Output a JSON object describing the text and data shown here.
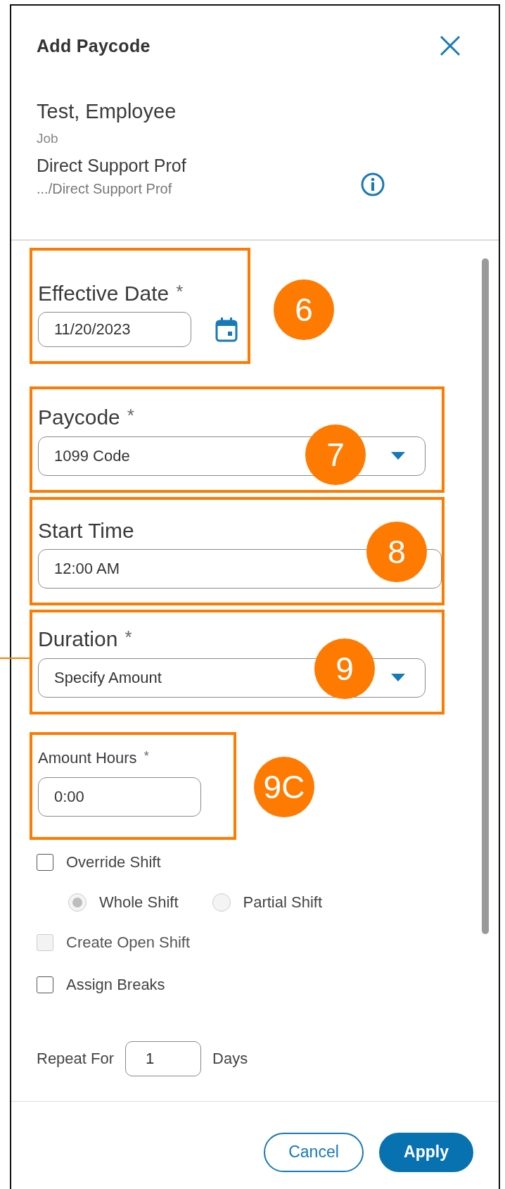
{
  "dialog": {
    "title": "Add Paycode",
    "employee": {
      "name": "Test, Employee",
      "job_label": "Job",
      "job": "Direct Support Prof",
      "job_path": ".../Direct Support Prof"
    },
    "fields": [
      {
        "kind": "date",
        "label": "Effective Date",
        "required_mark": "*",
        "value": "11/20/2023",
        "callout": "6",
        "leader": false
      },
      {
        "kind": "select",
        "label": "Paycode",
        "required_mark": "*",
        "value": "1099 Code",
        "callout": "7",
        "leader": false
      },
      {
        "kind": "time",
        "label": "Start Time",
        "value": "12:00 AM",
        "callout": "8",
        "leader": false
      },
      {
        "kind": "select",
        "label": "Duration",
        "required_mark": "*",
        "value": "Specify Amount",
        "callout": "9",
        "leader": true
      },
      {
        "kind": "hours",
        "label": "Amount Hours",
        "required_mark": "*",
        "value": "0:00",
        "callout": "9C",
        "leader": false
      }
    ],
    "options": [
      {
        "kind": "checkbox",
        "label": "Override Shift",
        "checked": false,
        "disabled": false
      },
      {
        "kind": "radios",
        "items": [
          {
            "label": "Whole Shift",
            "selected": true,
            "disabled": true
          },
          {
            "label": "Partial Shift",
            "selected": false,
            "disabled": true
          }
        ]
      },
      {
        "kind": "checkbox",
        "label": "Create Open Shift",
        "checked": false,
        "disabled": true
      },
      {
        "kind": "checkbox",
        "label": "Assign Breaks",
        "checked": false,
        "disabled": false
      }
    ],
    "repeat": {
      "label": "Repeat For",
      "value": "1",
      "unit": "Days"
    },
    "buttons": [
      {
        "kind": "secondary",
        "label": "Cancel"
      },
      {
        "kind": "primary",
        "label": "Apply"
      }
    ]
  }
}
